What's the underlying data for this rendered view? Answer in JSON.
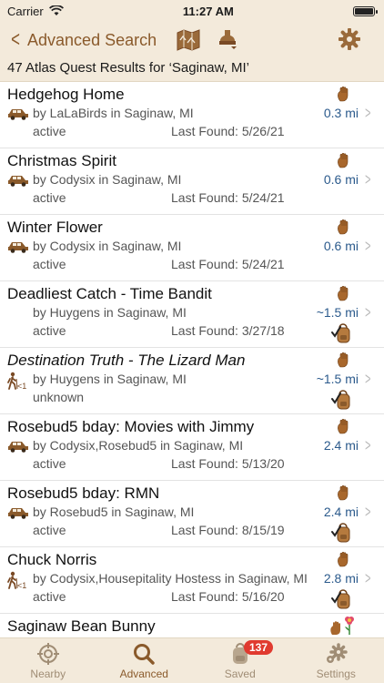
{
  "status_bar": {
    "carrier": "Carrier",
    "time": "11:27 AM"
  },
  "nav": {
    "back_label": "Advanced Search",
    "icons": [
      "map-icon",
      "stamp-icon",
      "gear-icon"
    ]
  },
  "results_header": "47 Atlas Quest Results for ‘Saginaw, MI’",
  "accent_color": "#8a5a2b",
  "rows": [
    {
      "title": "Hedgehog Home",
      "owner": "by LaLaBirds in Saginaw, MI",
      "status": "active",
      "found": "Last Found: 5/26/21",
      "distance": "0.3 mi",
      "icon": "car-icon",
      "italic": false,
      "bag": false
    },
    {
      "title": "Christmas Spirit",
      "owner": "by Codysix in Saginaw, MI",
      "status": "active",
      "found": "Last Found: 5/24/21",
      "distance": "0.6 mi",
      "icon": "car-icon",
      "italic": false,
      "bag": false
    },
    {
      "title": "Winter Flower",
      "owner": "by Codysix in Saginaw, MI",
      "status": "active",
      "found": "Last Found: 5/24/21",
      "distance": "0.6 mi",
      "icon": "car-icon",
      "italic": false,
      "bag": false
    },
    {
      "title": "Deadliest Catch - Time Bandit",
      "owner": "by Huygens in Saginaw, MI",
      "status": "active",
      "found": "Last Found: 3/27/18",
      "distance": "~1.5 mi",
      "icon": "",
      "italic": false,
      "bag": true
    },
    {
      "title": "Destination Truth - The Lizard Man",
      "owner": "by Huygens in Saginaw, MI",
      "status": "unknown",
      "found": "",
      "distance": "~1.5 mi",
      "icon": "hiker-icon",
      "italic": true,
      "bag": true
    },
    {
      "title": "Rosebud5 bday: Movies with Jimmy",
      "owner": "by Codysix,Rosebud5 in Saginaw, MI",
      "status": "active",
      "found": "Last Found: 5/13/20",
      "distance": "2.4 mi",
      "icon": "car-icon",
      "italic": false,
      "bag": false
    },
    {
      "title": "Rosebud5 bday: RMN",
      "owner": "by Rosebud5 in Saginaw, MI",
      "status": "active",
      "found": "Last Found: 8/15/19",
      "distance": "2.4 mi",
      "icon": "car-icon",
      "italic": false,
      "bag": true
    },
    {
      "title": "Chuck Norris",
      "owner": "by Codysix,Housepitality Hostess in Saginaw, MI",
      "status": "active",
      "found": "Last Found: 5/16/20",
      "distance": "2.8 mi",
      "icon": "hiker-icon",
      "italic": false,
      "bag": true
    },
    {
      "title": "Saginaw Bean Bunny",
      "owner": "",
      "status": "",
      "found": "",
      "distance": "",
      "icon": "",
      "italic": false,
      "bag": false
    }
  ],
  "hiker_sub": "<1",
  "tabs": [
    {
      "label": "Nearby",
      "icon": "crosshair-icon"
    },
    {
      "label": "Advanced",
      "icon": "search-icon"
    },
    {
      "label": "Saved",
      "icon": "backpack-icon",
      "badge": "137"
    },
    {
      "label": "Settings",
      "icon": "gears-icon"
    }
  ]
}
